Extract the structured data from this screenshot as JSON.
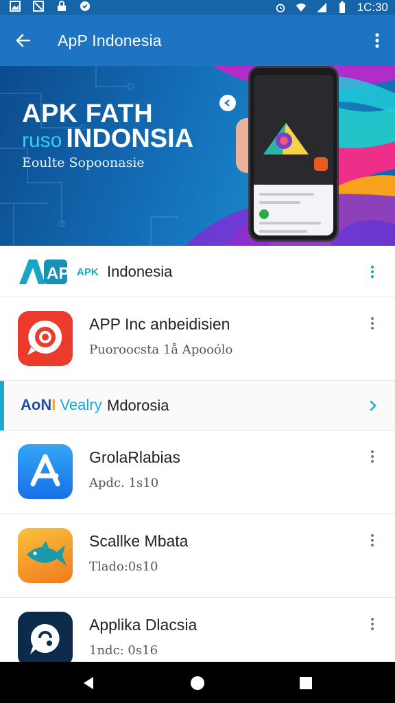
{
  "status_bar": {
    "time": "1C:30",
    "left_icons": [
      "image-icon",
      "no-sim-icon",
      "lock-icon",
      "shield-icon"
    ],
    "right_icons": [
      "alarm-icon",
      "wifi-icon",
      "battery-icon"
    ]
  },
  "app_bar": {
    "title": "ApP Indonesia",
    "back_icon": "arrow-left-icon",
    "menu_icon": "more-vert-icon",
    "color": "#1d74c2"
  },
  "banner": {
    "line1": "APK FATH",
    "accent": "ruso",
    "line2": "INDONSIA",
    "subtitle": "Eoulte Sopoonasie"
  },
  "brand_header": {
    "logo_text": "APP",
    "small": "APK",
    "text": "Indonesia"
  },
  "section": {
    "brand_b1": "AoN",
    "brand_b2": "I",
    "brand_b3": "Vealry",
    "text": "Mdorosia"
  },
  "apps": [
    {
      "name": "APP Inc anbeidisien",
      "sub": "Puoroocsta 1å Apooólo",
      "icon": "target-icon",
      "color": "#ea3b2d"
    },
    {
      "name": "GrolaRlabias",
      "sub": "Apdc. 1s10",
      "icon": "app-store-icon",
      "color": "#1e8ff0"
    },
    {
      "name": "Scallke Mbata",
      "sub": "Tlado:0s10",
      "icon": "fish-icon",
      "color": "#f7a21c"
    },
    {
      "name": "Applika Dlacsia",
      "sub": "1ndc: 0s16",
      "icon": "chat-bubble-icon",
      "color": "#0c2a4a"
    }
  ],
  "nav": {
    "back": "back-triangle-icon",
    "home": "home-circle-icon",
    "recents": "recents-square-icon"
  }
}
